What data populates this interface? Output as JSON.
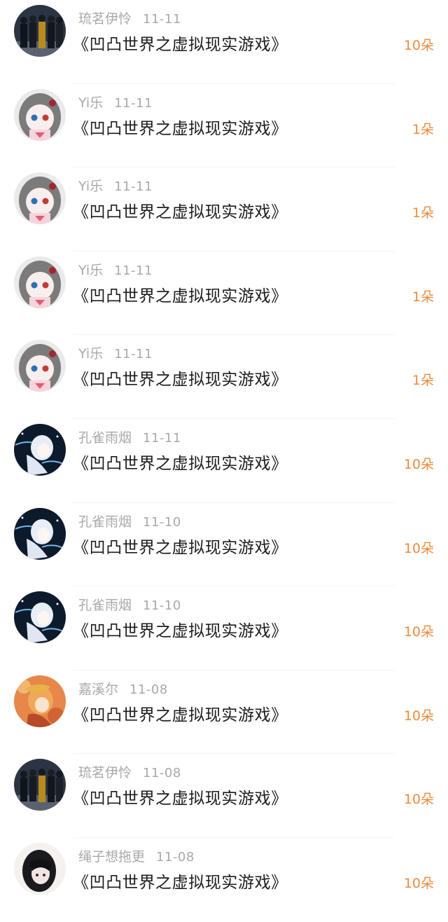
{
  "accent_color": "#ee8a3c",
  "records": [
    {
      "user": "琉茗伊怜",
      "date": "11-11",
      "title": "《凹凸世界之虚拟现实游戏》",
      "amount": "10朵",
      "avatar": "group-photo-avatar"
    },
    {
      "user": "Yi乐",
      "date": "11-11",
      "title": "《凹凸世界之虚拟现实游戏》",
      "amount": "1朵",
      "avatar": "anime-girl-avatar"
    },
    {
      "user": "Yi乐",
      "date": "11-11",
      "title": "《凹凸世界之虚拟现实游戏》",
      "amount": "1朵",
      "avatar": "anime-girl-avatar"
    },
    {
      "user": "Yi乐",
      "date": "11-11",
      "title": "《凹凸世界之虚拟现实游戏》",
      "amount": "1朵",
      "avatar": "anime-girl-avatar"
    },
    {
      "user": "Yi乐",
      "date": "11-11",
      "title": "《凹凸世界之虚拟现实游戏》",
      "amount": "1朵",
      "avatar": "anime-girl-avatar"
    },
    {
      "user": "孔雀雨烟",
      "date": "11-11",
      "title": "《凹凸世界之虚拟现实游戏》",
      "amount": "10朵",
      "avatar": "white-hair-character-avatar"
    },
    {
      "user": "孔雀雨烟",
      "date": "11-10",
      "title": "《凹凸世界之虚拟现实游戏》",
      "amount": "10朵",
      "avatar": "white-hair-character-avatar"
    },
    {
      "user": "孔雀雨烟",
      "date": "11-10",
      "title": "《凹凸世界之虚拟现实游戏》",
      "amount": "10朵",
      "avatar": "white-hair-character-avatar"
    },
    {
      "user": "嘉溪尔",
      "date": "11-08",
      "title": "《凹凸世界之虚拟现实游戏》",
      "amount": "10朵",
      "avatar": "orange-hair-character-avatar"
    },
    {
      "user": "琉茗伊怜",
      "date": "11-08",
      "title": "《凹凸世界之虚拟现实游戏》",
      "amount": "10朵",
      "avatar": "group-photo-avatar"
    },
    {
      "user": "绳子想拖更",
      "date": "11-08",
      "title": "《凹凸世界之虚拟现实游戏》",
      "amount": "10朵",
      "avatar": "dark-hair-character-avatar"
    }
  ]
}
